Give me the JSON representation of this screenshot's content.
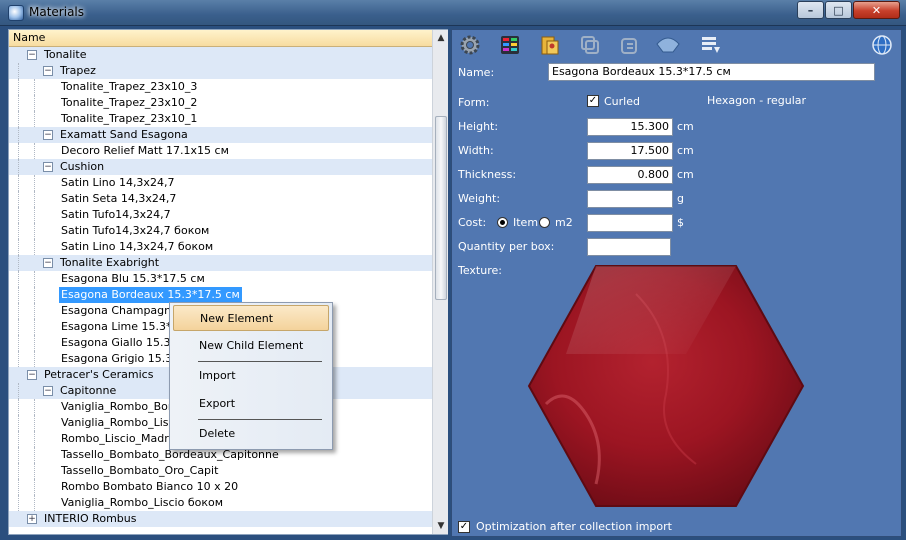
{
  "window": {
    "title": "Materials",
    "min": "–",
    "max": "□",
    "close": "✕"
  },
  "tree": {
    "header": "Name",
    "rows": [
      {
        "label": "Tonalite",
        "level": 0,
        "group": true,
        "exp": "−"
      },
      {
        "label": "Trapez",
        "level": 1,
        "group": true,
        "exp": "−"
      },
      {
        "label": "Tonalite_Trapez_23x10_3",
        "level": 2
      },
      {
        "label": "Tonalite_Trapez_23x10_2",
        "level": 2
      },
      {
        "label": "Tonalite_Trapez_23x10_1",
        "level": 2
      },
      {
        "label": "Examatt Sand Esagona",
        "level": 1,
        "group": true,
        "exp": "−"
      },
      {
        "label": "Decoro Relief Matt 17.1x15 см",
        "level": 2
      },
      {
        "label": "Cushion",
        "level": 1,
        "group": true,
        "exp": "−"
      },
      {
        "label": "Satin Lino 14,3x24,7",
        "level": 2
      },
      {
        "label": "Satin Seta 14,3x24,7",
        "level": 2
      },
      {
        "label": "Satin Tufo14,3x24,7",
        "level": 2
      },
      {
        "label": "Satin Tufo14,3x24,7 боком",
        "level": 2
      },
      {
        "label": "Satin Lino 14,3x24,7 боком",
        "level": 2
      },
      {
        "label": "Tonalite Exabright",
        "level": 1,
        "group": true,
        "exp": "−"
      },
      {
        "label": "Esagona Blu 15.3*17.5 см",
        "level": 2
      },
      {
        "label": "Esagona Bordeaux 15.3*17.5 см",
        "level": 2,
        "selected": true
      },
      {
        "label": "Esagona Champagne 15.3*17.5 см",
        "level": 2
      },
      {
        "label": "Esagona Lime 15.3*17.5 см",
        "level": 2
      },
      {
        "label": "Esagona Giallo 15.3*17.5 см",
        "level": 2
      },
      {
        "label": "Esagona Grigio 15.3*17.5 см",
        "level": 2
      },
      {
        "label": "Petracer's Ceramics",
        "level": 0,
        "group": true,
        "exp": "−"
      },
      {
        "label": "Capitonne",
        "level": 1,
        "group": true,
        "exp": "−"
      },
      {
        "label": "Vaniglia_Rombo_Bombato",
        "level": 2
      },
      {
        "label": "Vaniglia_Rombo_Liscio",
        "level": 2
      },
      {
        "label": "Rombo_Liscio_Madreperla",
        "level": 2
      },
      {
        "label": "Tassello_Bombato_Bordeaux_Capitonne",
        "level": 2
      },
      {
        "label": "Tassello_Bombato_Oro_Capit",
        "level": 2
      },
      {
        "label": "Rombo Bombato Bianco 10 x 20",
        "level": 2
      },
      {
        "label": "Vaniglia_Rombo_Liscio боком",
        "level": 2
      },
      {
        "label": "INTERIO Rombus",
        "level": 0,
        "group": true,
        "exp": "+"
      }
    ],
    "scroll_up": "▲",
    "scroll_down": "▼"
  },
  "context_menu": {
    "items": [
      "New Element",
      "New Child Element",
      "Import",
      "Export",
      "Delete"
    ],
    "hovered": "New Element"
  },
  "toolbar": {
    "icons": [
      "gear-icon",
      "palette-icon",
      "folder-icon",
      "copy-icon",
      "paste-icon",
      "shape-icon",
      "list-icon",
      "globe-icon"
    ]
  },
  "properties": {
    "name_label": "Name:",
    "name_value": "Esagona Bordeaux 15.3*17.5 см",
    "form_label": "Form:",
    "curled_label": "Curled",
    "curled_checked": true,
    "shape_name": "Hexagon - regular",
    "height_label": "Height:",
    "height_value": "15.300",
    "height_unit": "cm",
    "width_label": "Width:",
    "width_value": "17.500",
    "width_unit": "cm",
    "thickness_label": "Thickness:",
    "thickness_value": "0.800",
    "thickness_unit": "cm",
    "weight_label": "Weight:",
    "weight_value": "",
    "weight_unit": "g",
    "cost_label": "Cost:",
    "cost_item_label": "Item",
    "cost_m2_label": "m2",
    "cost_value": "",
    "cost_unit": "$",
    "qty_label": "Quantity per box:",
    "qty_value": "",
    "texture_label": "Texture:",
    "optimization_label": "Optimization after collection import",
    "optimization_checked": true
  },
  "colors": {
    "panel_bg": "#5177b1",
    "tile": "#9c1522",
    "selection": "#3399ff"
  }
}
